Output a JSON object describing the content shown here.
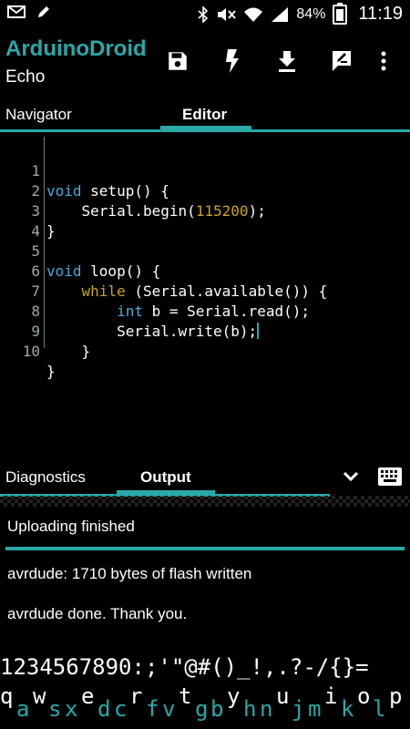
{
  "status_bar": {
    "battery_percent": "84%",
    "time": "11:19",
    "left_icons": [
      "mail-icon",
      "pencil-icon"
    ],
    "right_icons": [
      "bluetooth-icon",
      "mute-icon",
      "wifi-icon",
      "signal-icon",
      "battery-icon"
    ]
  },
  "appbar": {
    "title": "ArduinoDroid",
    "subtitle": "Echo",
    "actions": [
      "save-icon",
      "flash-icon",
      "download-icon",
      "edit-icon",
      "more-vert-icon"
    ]
  },
  "tabs": {
    "navigator": "Navigator",
    "editor": "Editor"
  },
  "editor": {
    "line_numbers": [
      "1",
      "2",
      "3",
      "4",
      "5",
      "6",
      "7",
      "8",
      "9",
      "10"
    ]
  },
  "bottom_panel": {
    "tabs": {
      "diagnostics": "Diagnostics",
      "output": "Output"
    }
  },
  "output": {
    "status": "Uploading finished",
    "lines": [
      "avrdude: 1710 bytes of flash written",
      "avrdude done.  Thank you."
    ]
  },
  "keyboard": {
    "symbols": "1234567890:;'\"@#()_!,.?-/{}=",
    "letters": [
      "q",
      "a",
      "w",
      "s",
      "x",
      "e",
      "d",
      "c",
      "r",
      "f",
      "v",
      "t",
      "g",
      "b",
      "y",
      "h",
      "n",
      "u",
      "j",
      "m",
      "i",
      "k",
      "o",
      "l",
      "p"
    ]
  },
  "colors": {
    "accent": "#2aa7a7",
    "keyword": "#4ea8d8",
    "number": "#c9a227"
  }
}
